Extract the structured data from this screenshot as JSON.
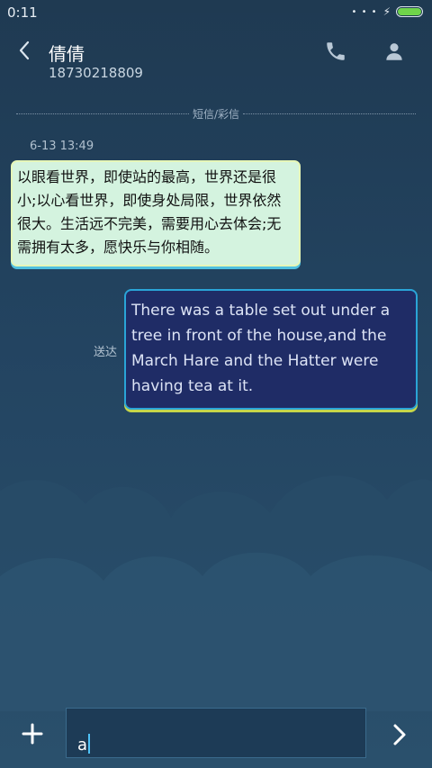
{
  "status_bar": {
    "time": "0:11",
    "signal_dots": "• • •",
    "charging_icon": "bolt-icon",
    "battery_color": "#6fd44b"
  },
  "header": {
    "contact_name": "倩倩",
    "contact_number": "18730218809",
    "back_icon": "back-chevron-icon",
    "call_icon": "phone-icon",
    "contact_icon": "person-icon"
  },
  "conversation": {
    "divider_label": "短信/彩信",
    "timestamp": "6-13 13:49",
    "incoming_message": "以眼看世界，即使站的最高，世界还是很小;以心看世界，即使身处局限，世界依然很大。生活远不完美，需要用心去体会;无需拥有太多，愿快乐与你相随。",
    "outgoing_message": "There was a table set out under a tree in front of the house,and the March Hare and the Hatter were having tea at it.",
    "outgoing_status": "送达"
  },
  "composer": {
    "input_value": "a",
    "add_icon": "plus-icon",
    "send_icon": "send-chevron-icon"
  },
  "colors": {
    "incoming_bubble": "#d4f3df",
    "outgoing_bubble": "#1f2c66",
    "background": "#234461"
  }
}
